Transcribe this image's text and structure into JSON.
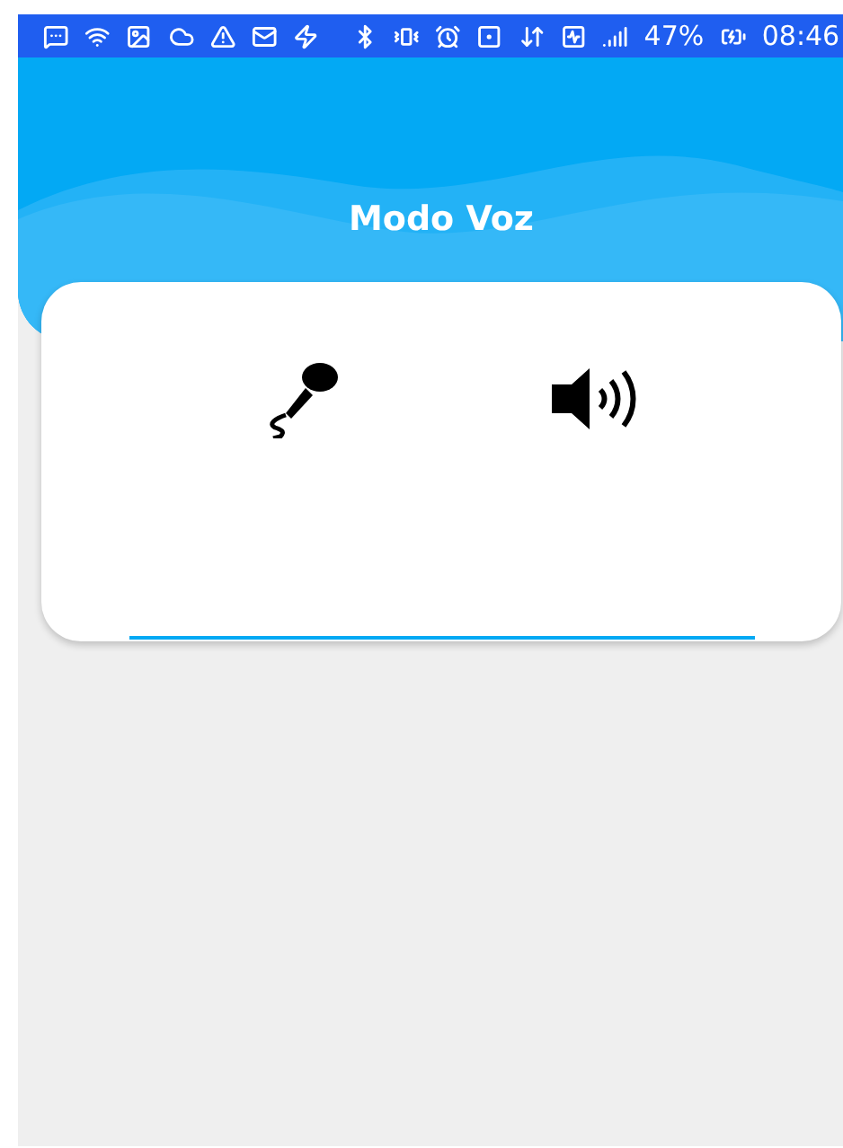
{
  "status_bar": {
    "battery": "47%",
    "time": "08:46"
  },
  "header": {
    "title": "Modo Voz"
  },
  "voice_card": {
    "input": {
      "focused": true
    }
  }
}
